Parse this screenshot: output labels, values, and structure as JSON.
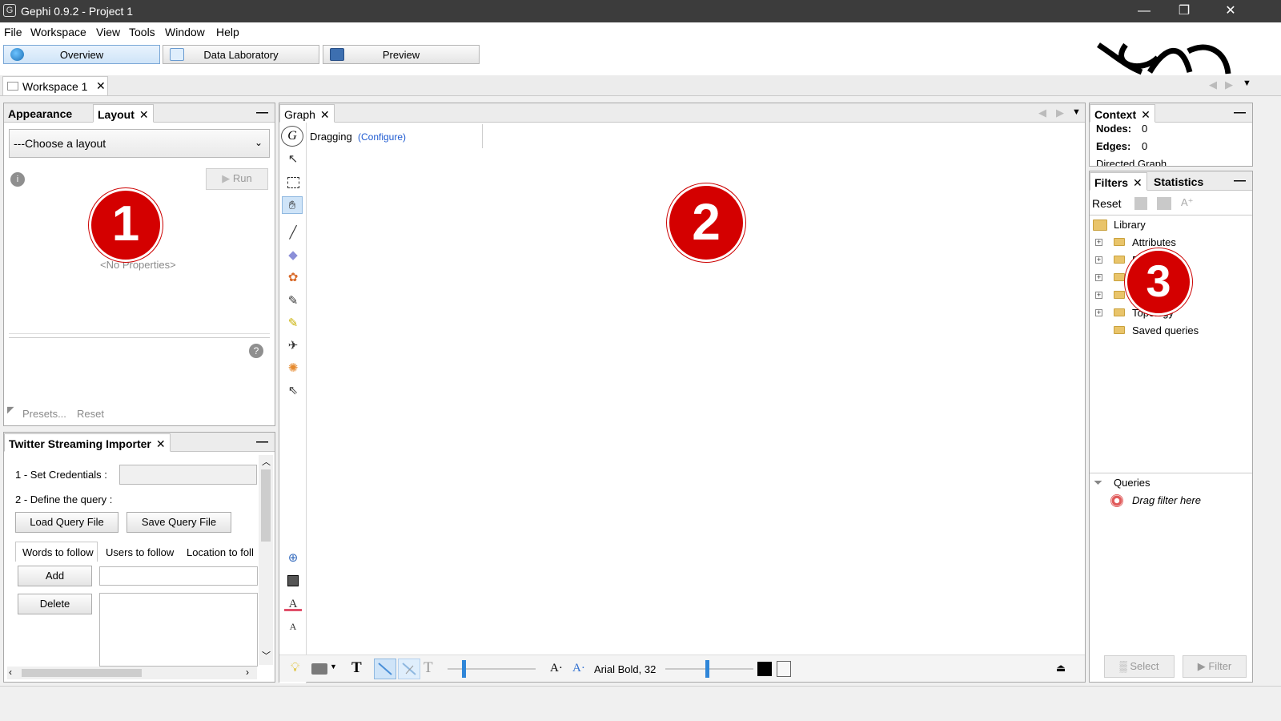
{
  "window": {
    "title": "Gephi 0.9.2 - Project 1",
    "minimize": "—",
    "restore": "❐",
    "close": "✕"
  },
  "menu": [
    "File",
    "Workspace",
    "View",
    "Tools",
    "Window",
    "Help"
  ],
  "modes": {
    "overview": "Overview",
    "data_lab": "Data Laboratory",
    "preview": "Preview"
  },
  "workspace_tab": "Workspace 1",
  "left_panel": {
    "tabs": {
      "appearance": "Appearance",
      "layout": "Layout"
    },
    "layout_select": "---Choose a layout",
    "run": "Run",
    "no_properties": "<No Properties>",
    "presets": "Presets...",
    "reset": "Reset",
    "badge": "1"
  },
  "twitter": {
    "title": "Twitter Streaming Importer",
    "set_credentials": "1 - Set Credentials :",
    "define_query": "2 - Define the query :",
    "load": "Load Query File",
    "save": "Save Query File",
    "subtabs": [
      "Words to follow",
      "Users to follow",
      "Location to foll"
    ],
    "add": "Add",
    "delete": "Delete"
  },
  "graph": {
    "tab": "Graph",
    "mode": "Dragging",
    "configure": "(Configure)",
    "badge": "2",
    "font": "Arial Bold, 32"
  },
  "context": {
    "tab": "Context",
    "nodes_label": "Nodes:",
    "nodes": "0",
    "edges_label": "Edges:",
    "edges": "0",
    "graph_type": "Directed Graph"
  },
  "filters": {
    "tabs": {
      "filters": "Filters",
      "statistics": "Statistics"
    },
    "reset": "Reset",
    "library": "Library",
    "items": [
      "Attributes",
      "E",
      "",
      "",
      "Topology",
      "Saved queries"
    ],
    "badge": "3",
    "queries": "Queries",
    "drag_hint": "Drag filter here",
    "select": "Select",
    "filter": "Filter"
  }
}
